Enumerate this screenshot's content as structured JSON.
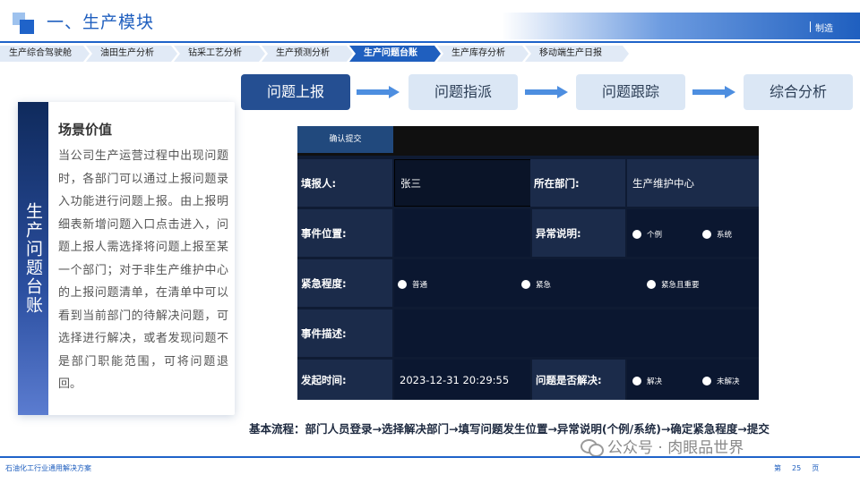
{
  "header": {
    "title": "一、生产模块",
    "tag": "制造"
  },
  "tabs": [
    {
      "label": "生产综合驾驶舱",
      "active": false
    },
    {
      "label": "油田生产分析",
      "active": false
    },
    {
      "label": "钻采工艺分析",
      "active": false
    },
    {
      "label": "生产预测分析",
      "active": false
    },
    {
      "label": "生产问题台账",
      "active": true
    },
    {
      "label": "生产库存分析",
      "active": false
    },
    {
      "label": "移动端生产日报",
      "active": false
    }
  ],
  "steps": [
    "问题上报",
    "问题指派",
    "问题跟踪",
    "综合分析"
  ],
  "sidebar_title": "生产问题台账",
  "card": {
    "heading": "场景价值",
    "body": "当公司生产运营过程中出现问题时，各部门可以通过上报问题录入功能进行问题上报。由上报明细表新增问题入口点击进入，问题上报人需选择将问题上报至某一个部门；对于非生产维护中心的上报问题清单，在清单中可以看到当前部门的待解决问题，可选择进行解决，或者发现问题不是部门职能范围，可将问题退回。"
  },
  "form": {
    "confirm_button": "确认提交",
    "reporter_label": "填报人:",
    "reporter_value": "张三",
    "dept_label": "所在部门:",
    "dept_value": "生产维护中心",
    "location_label": "事件位置:",
    "exception_label": "异常说明:",
    "exception_opt1": "个例",
    "exception_opt2": "系统",
    "urgency_label": "紧急程度:",
    "urgency_opt1": "普通",
    "urgency_opt2": "紧急",
    "urgency_opt3": "紧急且重要",
    "desc_label": "事件描述:",
    "time_label": "发起时间:",
    "time_value": "2023-12-31  20:29:55",
    "resolved_label": "问题是否解决:",
    "resolved_opt1": "解决",
    "resolved_opt2": "未解决"
  },
  "process_text": "基本流程：部门人员登录→选择解决部门→填写问题发生位置→异常说明(个例/系统)→确定紧急程度→提交",
  "watermark": "公众号 · 肉眼品世界",
  "footer": {
    "left": "石油化工行业通用解决方案",
    "page_prefix": "第",
    "page_num": "25",
    "page_suffix": "页"
  },
  "colors": {
    "primary": "#1f5fbf",
    "form_bg": "#0f1b33",
    "step_active": "#254f92",
    "step_idle": "#dbe7f5"
  }
}
